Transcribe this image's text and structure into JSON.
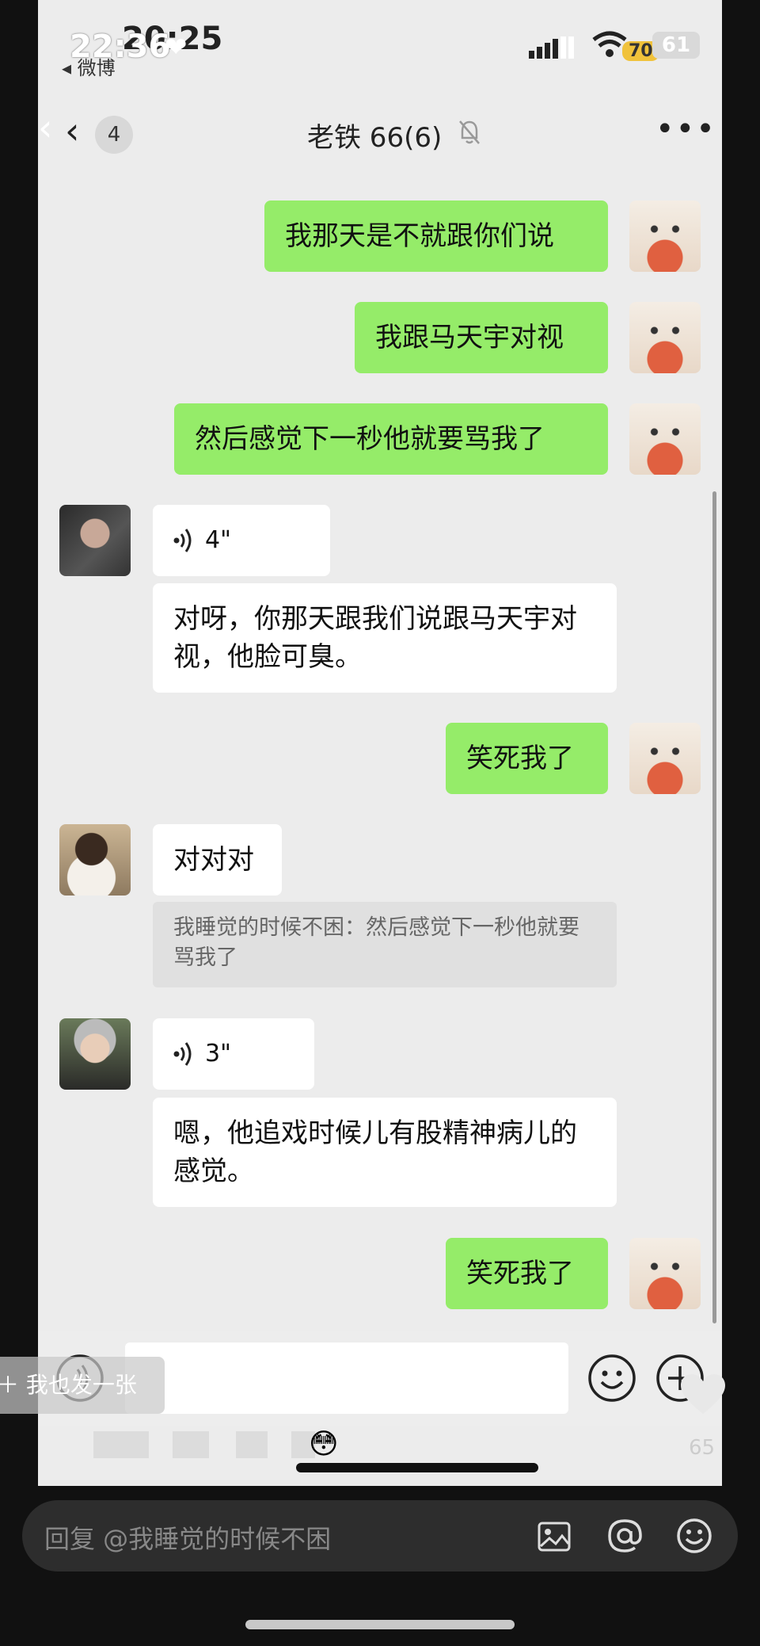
{
  "status_bar": {
    "time_behind": "20:25",
    "time_front": "22:36",
    "back_app": "◂ 微博",
    "battery_behind": "70",
    "battery_front": "61"
  },
  "nav": {
    "unread_count": "4",
    "title": "老铁 66(6)"
  },
  "messages": [
    {
      "side": "right",
      "type": "text",
      "text": "我那天是不就跟你们说"
    },
    {
      "side": "right",
      "type": "text",
      "text": "我跟马天宇对视"
    },
    {
      "side": "right",
      "type": "text",
      "text": "然后感觉下一秒他就要骂我了"
    },
    {
      "side": "left",
      "type": "voice",
      "duration": "4\""
    },
    {
      "side": "left",
      "type": "text",
      "text": "对呀，你那天跟我们说跟马天宇对视，他脸可臭。"
    },
    {
      "side": "right",
      "type": "text",
      "text": "笑死我了"
    },
    {
      "side": "left",
      "type": "text",
      "text": "对对对"
    },
    {
      "side": "left",
      "type": "quote",
      "text": "我睡觉的时候不困：然后感觉下一秒他就要骂我了"
    },
    {
      "side": "left",
      "type": "voice",
      "duration": "3\""
    },
    {
      "side": "left",
      "type": "text",
      "text": "嗯，他追戏时候儿有股精神病儿的感觉。"
    },
    {
      "side": "right",
      "type": "text",
      "text": "笑死我了"
    }
  ],
  "overlay": {
    "ghost_button": "＋ 我也发一张",
    "like_count": "65"
  },
  "reply_box": {
    "placeholder": "回复 @我睡觉的时候不困"
  },
  "colors": {
    "bubble_self": "#95ec69",
    "bubble_other": "#ffffff",
    "chat_bg": "#ececec"
  }
}
